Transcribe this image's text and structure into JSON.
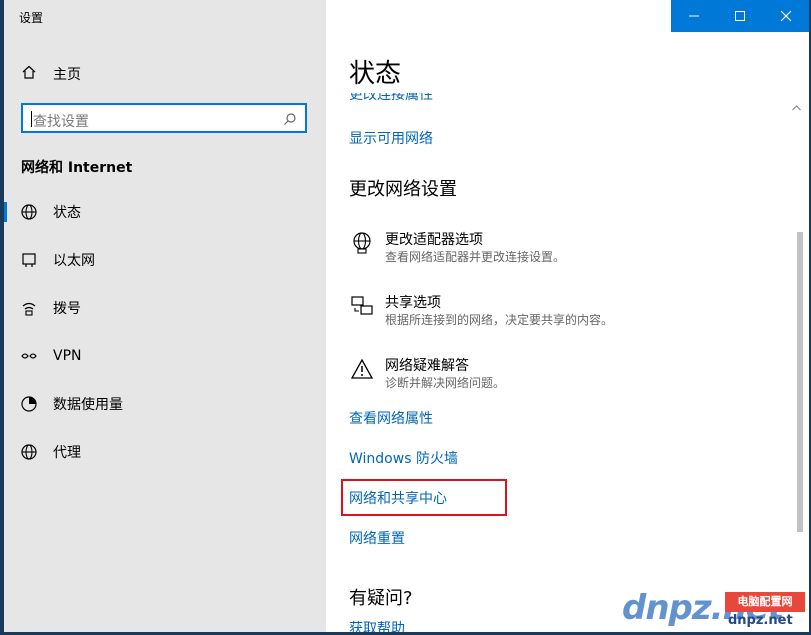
{
  "window": {
    "title": "设置"
  },
  "sidebar": {
    "home_label": "主页",
    "search_placeholder": "查找设置",
    "section_title": "网络和 Internet",
    "items": [
      {
        "label": "状态",
        "icon": "globe-icon",
        "selected": true
      },
      {
        "label": "以太网",
        "icon": "ethernet-icon",
        "selected": false
      },
      {
        "label": "拨号",
        "icon": "dialup-icon",
        "selected": false
      },
      {
        "label": "VPN",
        "icon": "vpn-icon",
        "selected": false
      },
      {
        "label": "数据使用量",
        "icon": "data-usage-icon",
        "selected": false
      },
      {
        "label": "代理",
        "icon": "proxy-globe-icon",
        "selected": false
      }
    ]
  },
  "main": {
    "title": "状态",
    "partial_link": "更改连接属性",
    "show_networks_link": "显示可用网络",
    "change_settings_title": "更改网络设置",
    "options": [
      {
        "title": "更改适配器选项",
        "desc": "查看网络适配器并更改连接设置。",
        "icon": "adapter-icon"
      },
      {
        "title": "共享选项",
        "desc": "根据所连接到的网络，决定要共享的内容。",
        "icon": "sharing-icon"
      },
      {
        "title": "网络疑难解答",
        "desc": "诊断并解决网络问题。",
        "icon": "warning-icon"
      }
    ],
    "links": {
      "view_properties": "查看网络属性",
      "firewall": "Windows 防火墙",
      "sharing_center": "网络和共享中心",
      "network_reset": "网络重置"
    },
    "faq_title": "有疑问?",
    "get_help": "获取帮助"
  },
  "watermark": {
    "logo": "dnpz.net",
    "badge": "电脑配置网",
    "url": "dnpz.net"
  },
  "colors": {
    "accent": "#0078d7",
    "link": "#0067b8",
    "highlight": "#d9141c",
    "sidebar_bg": "#e6e6e6"
  }
}
